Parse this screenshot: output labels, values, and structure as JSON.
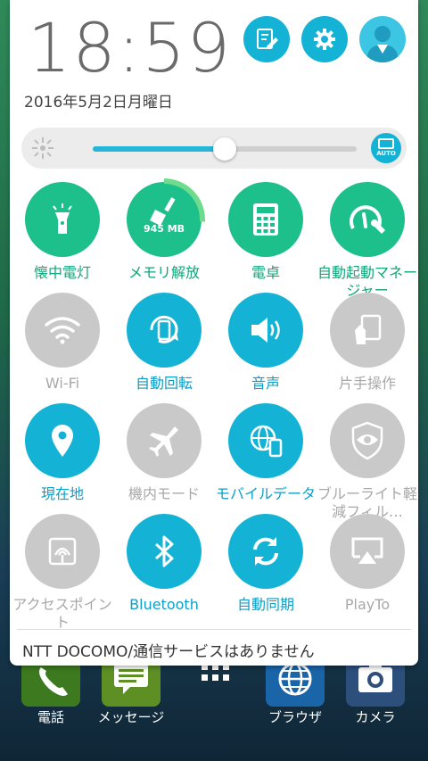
{
  "clock": {
    "time": "18:59",
    "date": "2016年5月2日月曜日"
  },
  "top_buttons": [
    {
      "name": "quick-notes-button",
      "icon": "notes-edit-icon"
    },
    {
      "name": "settings-button",
      "icon": "gear-icon"
    },
    {
      "name": "user-button",
      "icon": "user-avatar-icon"
    }
  ],
  "brightness": {
    "level": 0.5,
    "auto_label": "AUTO"
  },
  "tiles": [
    {
      "label": "懐中電灯",
      "icon": "flashlight-icon",
      "state": "on-green"
    },
    {
      "label": "メモリ解放",
      "icon": "broom-icon",
      "state": "on-green",
      "memory": "945 MB"
    },
    {
      "label": "電卓",
      "icon": "calculator-icon",
      "state": "on-green"
    },
    {
      "label": "自動起動マネージャー",
      "icon": "speedometer-wrench-icon",
      "state": "on-green"
    },
    {
      "label": "Wi-Fi",
      "icon": "wifi-icon",
      "state": "off"
    },
    {
      "label": "自動回転",
      "icon": "auto-rotate-icon",
      "state": "on-blue"
    },
    {
      "label": "音声",
      "icon": "speaker-icon",
      "state": "on-blue"
    },
    {
      "label": "片手操作",
      "icon": "one-hand-icon",
      "state": "off"
    },
    {
      "label": "現在地",
      "icon": "location-pin-icon",
      "state": "on-blue"
    },
    {
      "label": "機内モード",
      "icon": "airplane-icon",
      "state": "off"
    },
    {
      "label": "モバイルデータ",
      "icon": "globe-phone-icon",
      "state": "on-blue"
    },
    {
      "label": "ブルーライト軽減フィル…",
      "icon": "eye-shield-icon",
      "state": "off"
    },
    {
      "label": "アクセスポイント",
      "icon": "hotspot-icon",
      "state": "off"
    },
    {
      "label": "Bluetooth",
      "icon": "bluetooth-icon",
      "state": "on-blue"
    },
    {
      "label": "自動同期",
      "icon": "sync-icon",
      "state": "on-blue"
    },
    {
      "label": "PlayTo",
      "icon": "cast-icon",
      "state": "off"
    }
  ],
  "carrier_text": "NTT DOCOMO/通信サービスはありません",
  "home_apps": [
    {
      "label": "電話",
      "icon": "phone-icon"
    },
    {
      "label": "メッセージ",
      "icon": "message-icon"
    },
    {
      "label": "",
      "icon": "app-grid-icon"
    },
    {
      "label": "ブラウザ",
      "icon": "globe-icon"
    },
    {
      "label": "カメラ",
      "icon": "camera-icon"
    }
  ],
  "colors": {
    "accent_blue": "#14b3d6",
    "accent_green": "#1dbf8a",
    "inactive_gray": "#c9c9c9"
  }
}
